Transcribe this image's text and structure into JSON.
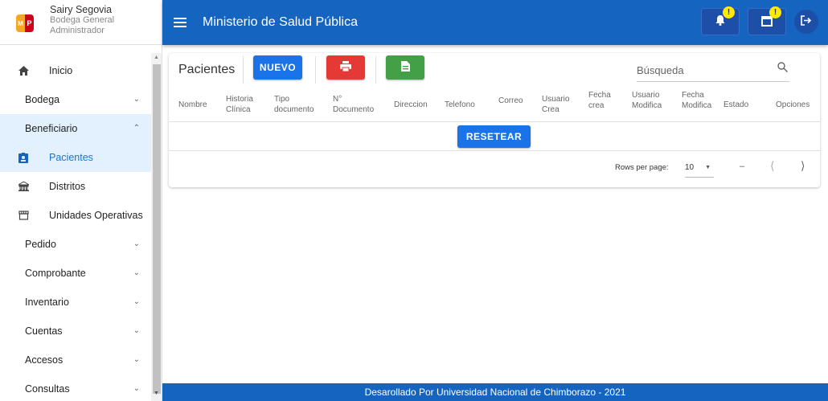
{
  "user": {
    "name": "Sairy Segovia",
    "unit": "Bodega General",
    "role": "Administrador",
    "logo_left": "M",
    "logo_right": "P"
  },
  "sidebar": {
    "items": [
      {
        "label": "Inicio",
        "icon": "home-icon"
      },
      {
        "label": "Bodega"
      },
      {
        "label": "Beneficiario"
      },
      {
        "label": "Pacientes",
        "icon": "badge-icon"
      },
      {
        "label": "Distritos",
        "icon": "building-icon"
      },
      {
        "label": "Unidades Operativas",
        "icon": "store-icon"
      },
      {
        "label": "Pedido"
      },
      {
        "label": "Comprobante"
      },
      {
        "label": "Inventario"
      },
      {
        "label": "Cuentas"
      },
      {
        "label": "Accesos"
      },
      {
        "label": "Consultas"
      }
    ]
  },
  "header": {
    "title": "Ministerio de Salud Pública",
    "notif_badge": "!",
    "calendar_badge": "!"
  },
  "main": {
    "title": "Pacientes",
    "new_label": "NUEVO",
    "search_placeholder": "Búsqueda",
    "columns": [
      "Nombre",
      "Historia Clínica",
      "Tipo documento",
      "N° Documento",
      "Direccion",
      "Telefono",
      "Correo",
      "Usuario Crea",
      "Fecha crea",
      "Usuario Modifica",
      "Fecha Modifica",
      "Estado",
      "Opciones"
    ],
    "reset_label": "RESETEAR",
    "rows_per_page_label": "Rows per page:",
    "rows_per_page_value": "10",
    "range_text": "–"
  },
  "footer": {
    "text": "Desarollado Por Universidad Nacional de Chimborazo - 2021"
  },
  "colors": {
    "primary": "#1565c0",
    "new_button": "#1a73e8",
    "print_button": "#e53935",
    "excel_button": "#43a047",
    "badge": "#ffeb00"
  }
}
